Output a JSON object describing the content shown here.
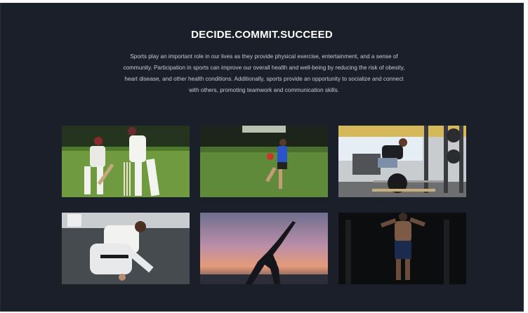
{
  "section": {
    "title": "DECIDE.COMMIT.SUCCEED",
    "description": "Sports play an important role in our lives as they provide physical exercise, entertainment, and a sense of community. Participation in sports can improve our overall health and well-being by reducing the risk of obesity, heart disease, and other health conditions. Additionally, sports provide an opportunity to socialize and connect with others, promoting teamwork and communication skills."
  },
  "gallery": {
    "items": [
      {
        "subject": "cricket"
      },
      {
        "subject": "football"
      },
      {
        "subject": "gym"
      },
      {
        "subject": "jiu-jitsu"
      },
      {
        "subject": "yoga"
      },
      {
        "subject": "fitness"
      }
    ]
  },
  "colors": {
    "background": "#1b1f29",
    "title": "#ffffff",
    "text": "#c8cbd2"
  }
}
